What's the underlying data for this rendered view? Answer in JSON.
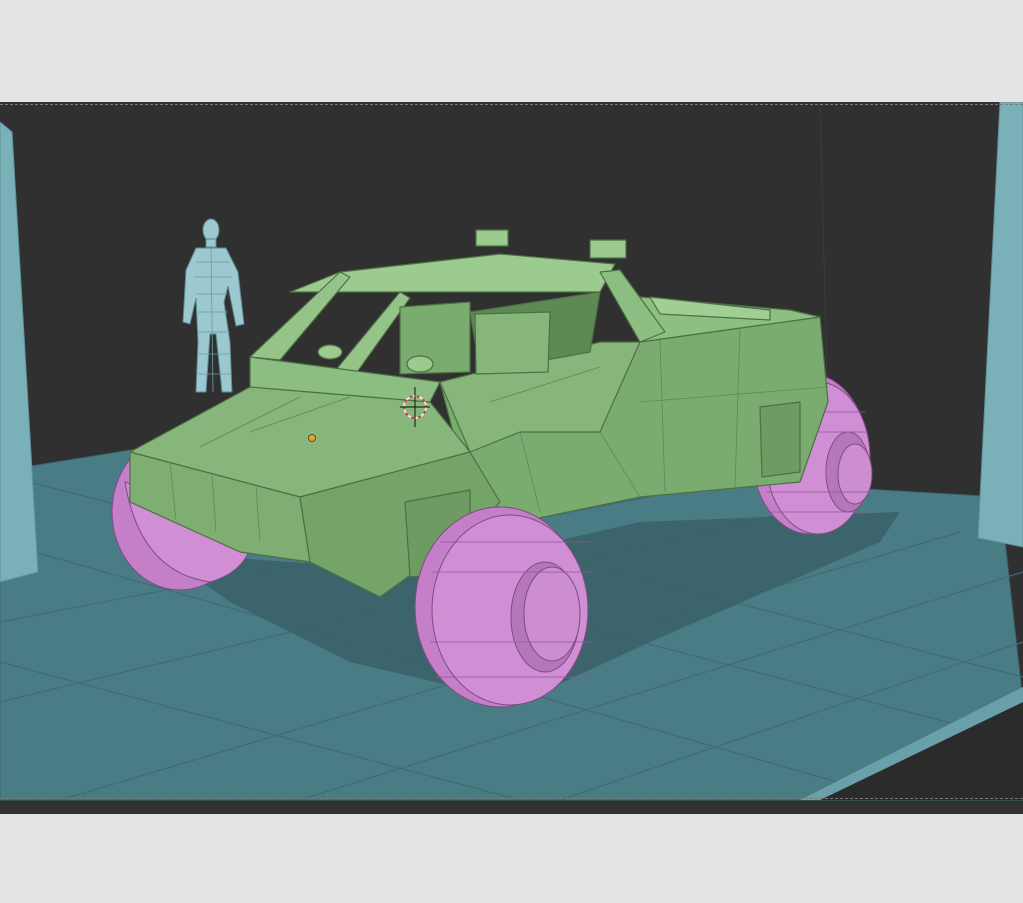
{
  "viewport": {
    "background": "#2f2f2f",
    "frame_background": "#e4e4e4"
  },
  "scene": {
    "objects": [
      {
        "name": "vehicle-body",
        "color": "#86b67a"
      },
      {
        "name": "wheel",
        "color": "#d08fd4",
        "count": 4
      },
      {
        "name": "human-reference-figure",
        "color": "#9cc8cf"
      },
      {
        "name": "ground-plane",
        "color": "#4a7c86"
      },
      {
        "name": "left-wall",
        "color": "#7ab1b8"
      },
      {
        "name": "right-wall",
        "color": "#7ab1b8"
      }
    ],
    "icons": [
      "3d-cursor-icon",
      "origin-point-icon"
    ]
  }
}
